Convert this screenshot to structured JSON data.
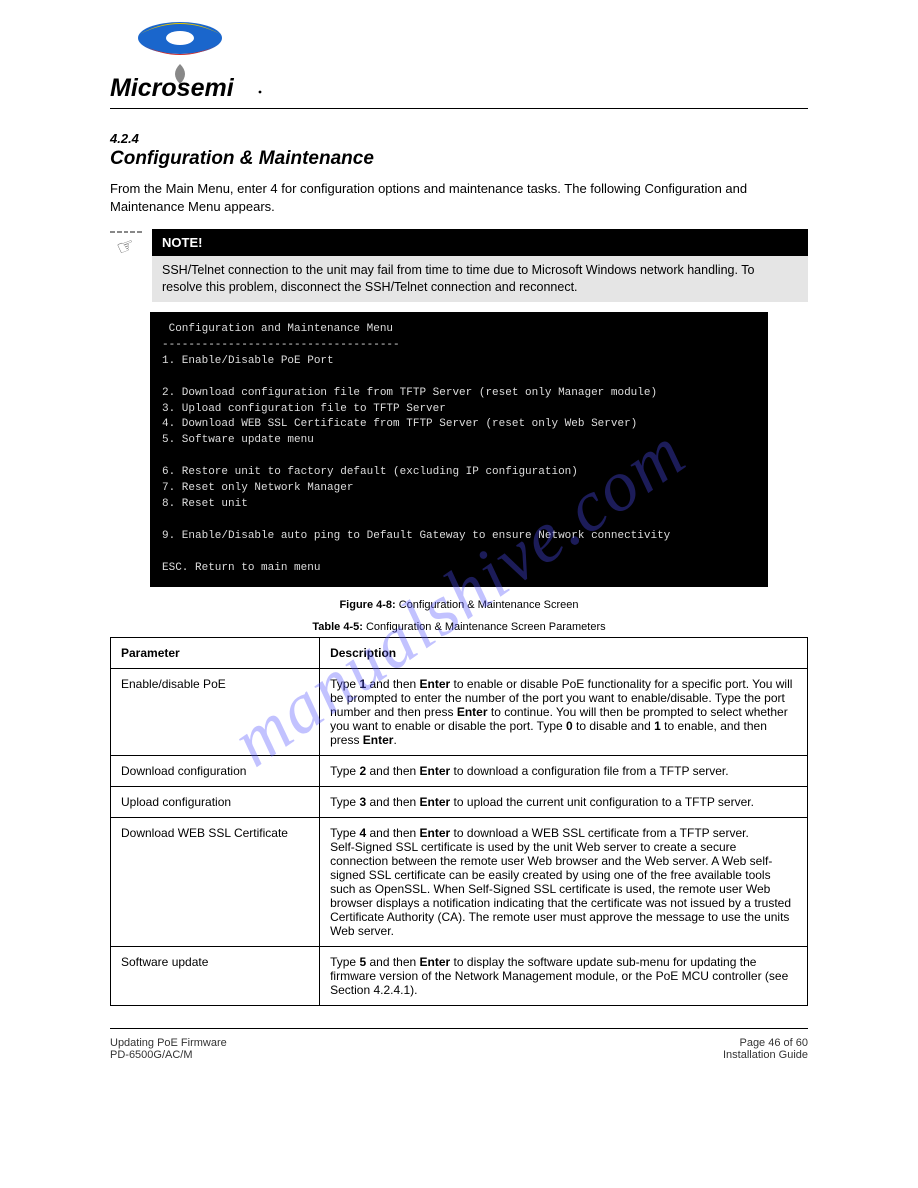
{
  "logo": {
    "name": "Microsemi"
  },
  "section": {
    "number": "4.2.4",
    "title": "Configuration & Maintenance",
    "description": "From the Main Menu, enter 4 for configuration options and maintenance tasks. The following Configuration and Maintenance Menu appears."
  },
  "note": {
    "heading": "NOTE!",
    "body": "SSH/Telnet connection to the unit may fail from time to time due to Microsoft Windows network handling. To resolve this problem, disconnect the SSH/Telnet connection and reconnect."
  },
  "terminal": {
    "title": " Configuration and Maintenance Menu",
    "divider": "------------------------------------",
    "lines": [
      "1. Enable/Disable PoE Port",
      "",
      "2. Download configuration file from TFTP Server (reset only Manager module)",
      "3. Upload configuration file to TFTP Server",
      "4. Download WEB SSL Certificate from TFTP Server (reset only Web Server)",
      "5. Software update menu",
      "",
      "6. Restore unit to factory default (excluding IP configuration)",
      "7. Reset only Network Manager",
      "8. Reset unit",
      "",
      "9. Enable/Disable auto ping to Default Gateway to ensure Network connectivity",
      "",
      "ESC. Return to main menu"
    ]
  },
  "figure": {
    "label": "Figure 4-8:",
    "caption": "Configuration & Maintenance Screen"
  },
  "tablecap": {
    "label": "Table 4-5:",
    "caption": "Configuration & Maintenance Screen Parameters"
  },
  "headers": {
    "param": "Parameter",
    "desc": "Description"
  },
  "rows": [
    {
      "param": "Enable/disable PoE",
      "desc_parts": [
        "Type ",
        {
          "b": "1"
        },
        " and then ",
        {
          "b": "Enter"
        },
        " to enable or disable PoE functionality for a specific port. You will be prompted to enter the number of the port you want to enable/disable. Type the port number and then press ",
        {
          "b": "Enter"
        },
        " to continue. You will then be prompted to select whether you want to enable or disable the port. Type ",
        {
          "b": "0"
        },
        " to disable and ",
        {
          "b": "1"
        },
        " to enable, and then press ",
        {
          "b": "Enter"
        },
        "."
      ]
    },
    {
      "param": "Download configuration",
      "desc_parts": [
        "Type ",
        {
          "b": "2"
        },
        " and then ",
        {
          "b": "Enter"
        },
        " to download a configuration file from a TFTP server."
      ]
    },
    {
      "param": "Upload configuration",
      "desc_parts": [
        "Type ",
        {
          "b": "3"
        },
        " and then ",
        {
          "b": "Enter"
        },
        " to upload the current unit configuration to a TFTP server."
      ]
    },
    {
      "param": "Download WEB SSL Certificate",
      "desc_parts": [
        "Type ",
        {
          "b": "4"
        },
        " and then ",
        {
          "b": "Enter"
        },
        " to download a WEB SSL certificate from a TFTP server.",
        {
          "br": true
        },
        "Self-Signed SSL certificate is used by the unit Web server to create a secure connection between the remote user Web browser and the Web server. A Web self-signed SSL certificate can be easily created by using one of the free available tools such as OpenSSL. When Self-Signed SSL certificate is used, the remote user Web browser displays a notification indicating that the certificate was not issued by a trusted Certificate Authority (CA). The remote user must approve the message to use the units Web server."
      ]
    },
    {
      "param": "Software update",
      "desc_parts": [
        "Type ",
        {
          "b": "5"
        },
        " and then ",
        {
          "b": "Enter"
        },
        " to display the software update sub-menu for updating the firmware version of the Network Management module, or the PoE MCU controller (see Section 4.2.4.1)."
      ]
    }
  ],
  "footer": {
    "left1": "Updating PoE Firmware",
    "left2": "PD-6500G/AC/M",
    "right1": "Page 46 of 60",
    "right2": "Installation Guide"
  },
  "watermark": "manualshive.com"
}
